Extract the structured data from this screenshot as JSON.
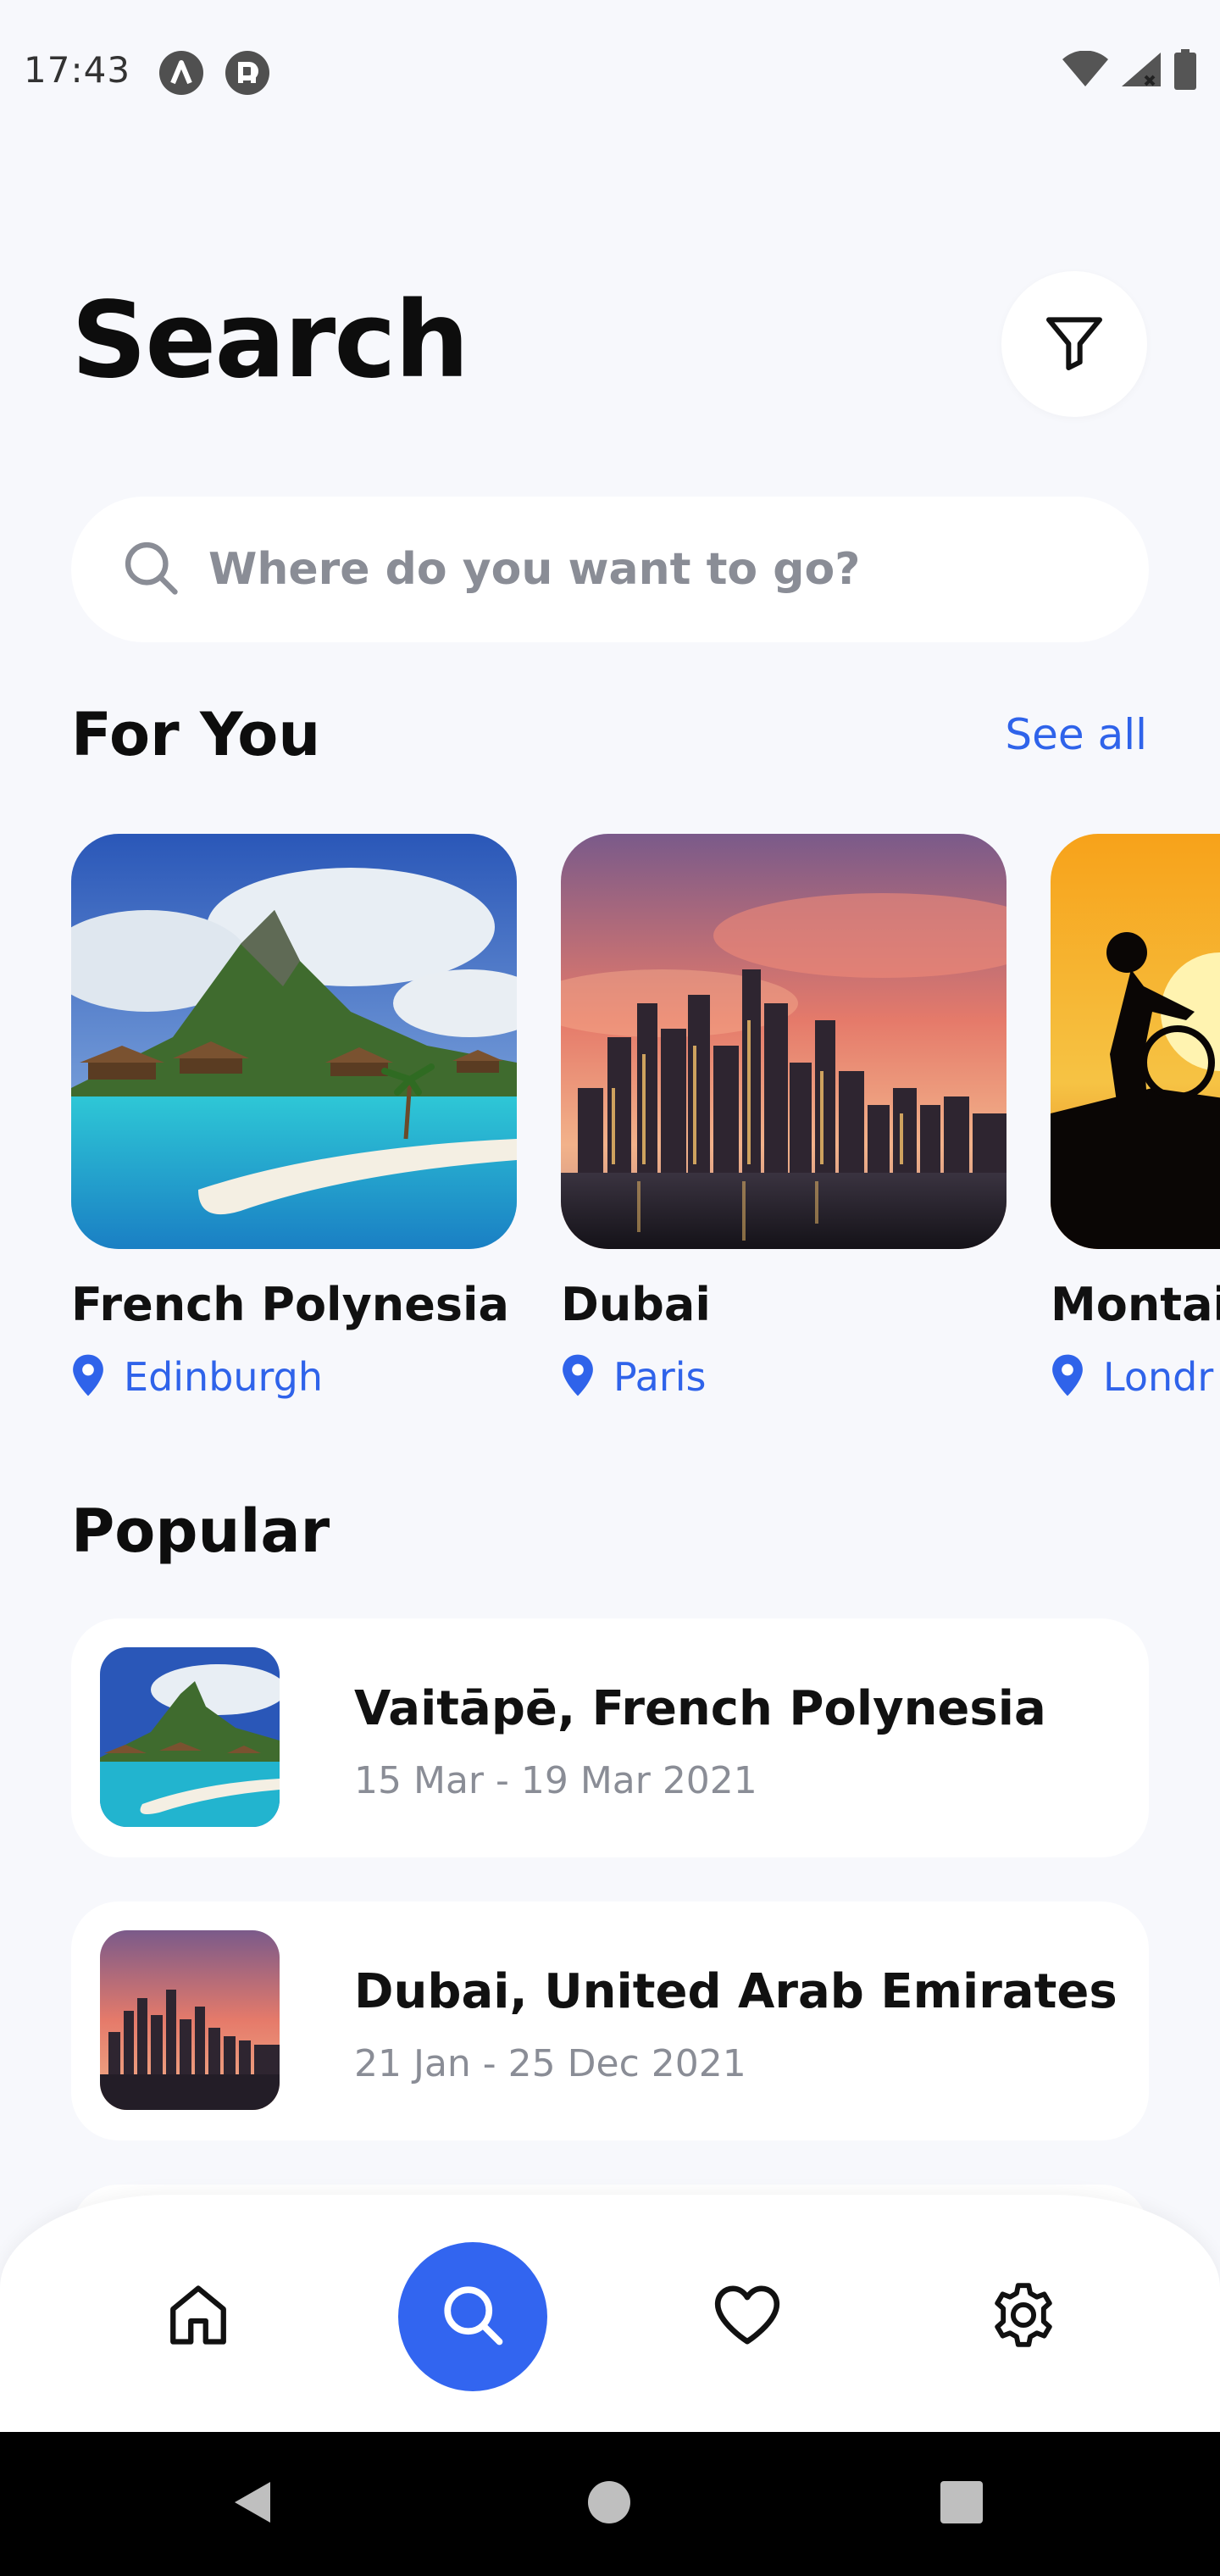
{
  "status_bar": {
    "time": "17:43",
    "icons": [
      "app-a-icon",
      "app-p-icon",
      "wifi-icon",
      "signal-icon",
      "battery-icon"
    ]
  },
  "header": {
    "title": "Search",
    "filter_icon": "filter-icon"
  },
  "search": {
    "placeholder": "Where do you want to go?",
    "value": "",
    "icon": "search-icon"
  },
  "for_you": {
    "title": "For You",
    "see_all_label": "See all",
    "cards": [
      {
        "name": "French Polynesia",
        "location": "Edinburgh",
        "image": "polynesia-photo"
      },
      {
        "name": "Dubai",
        "location": "Paris",
        "image": "dubai-photo"
      },
      {
        "name": "Montain",
        "location": "Londr",
        "image": "mountain-bike-photo"
      }
    ]
  },
  "popular": {
    "title": "Popular",
    "items": [
      {
        "title": "Vaitāpē, French Polynesia",
        "dates": "15 Mar - 19 Mar 2021",
        "image": "polynesia-photo"
      },
      {
        "title": "Dubai, United Arab Emirates",
        "dates": "21 Jan - 25 Dec 2021",
        "image": "dubai-photo"
      }
    ]
  },
  "bottom_nav": {
    "items": [
      {
        "name": "home",
        "icon": "home-icon",
        "active": false
      },
      {
        "name": "search",
        "icon": "search-icon",
        "active": true
      },
      {
        "name": "favorites",
        "icon": "heart-icon",
        "active": false
      },
      {
        "name": "settings",
        "icon": "gear-icon",
        "active": false
      }
    ]
  },
  "colors": {
    "accent": "#2f63ea",
    "background": "#f7f8fc",
    "card": "#ffffff",
    "muted_text": "#8a8d96"
  }
}
